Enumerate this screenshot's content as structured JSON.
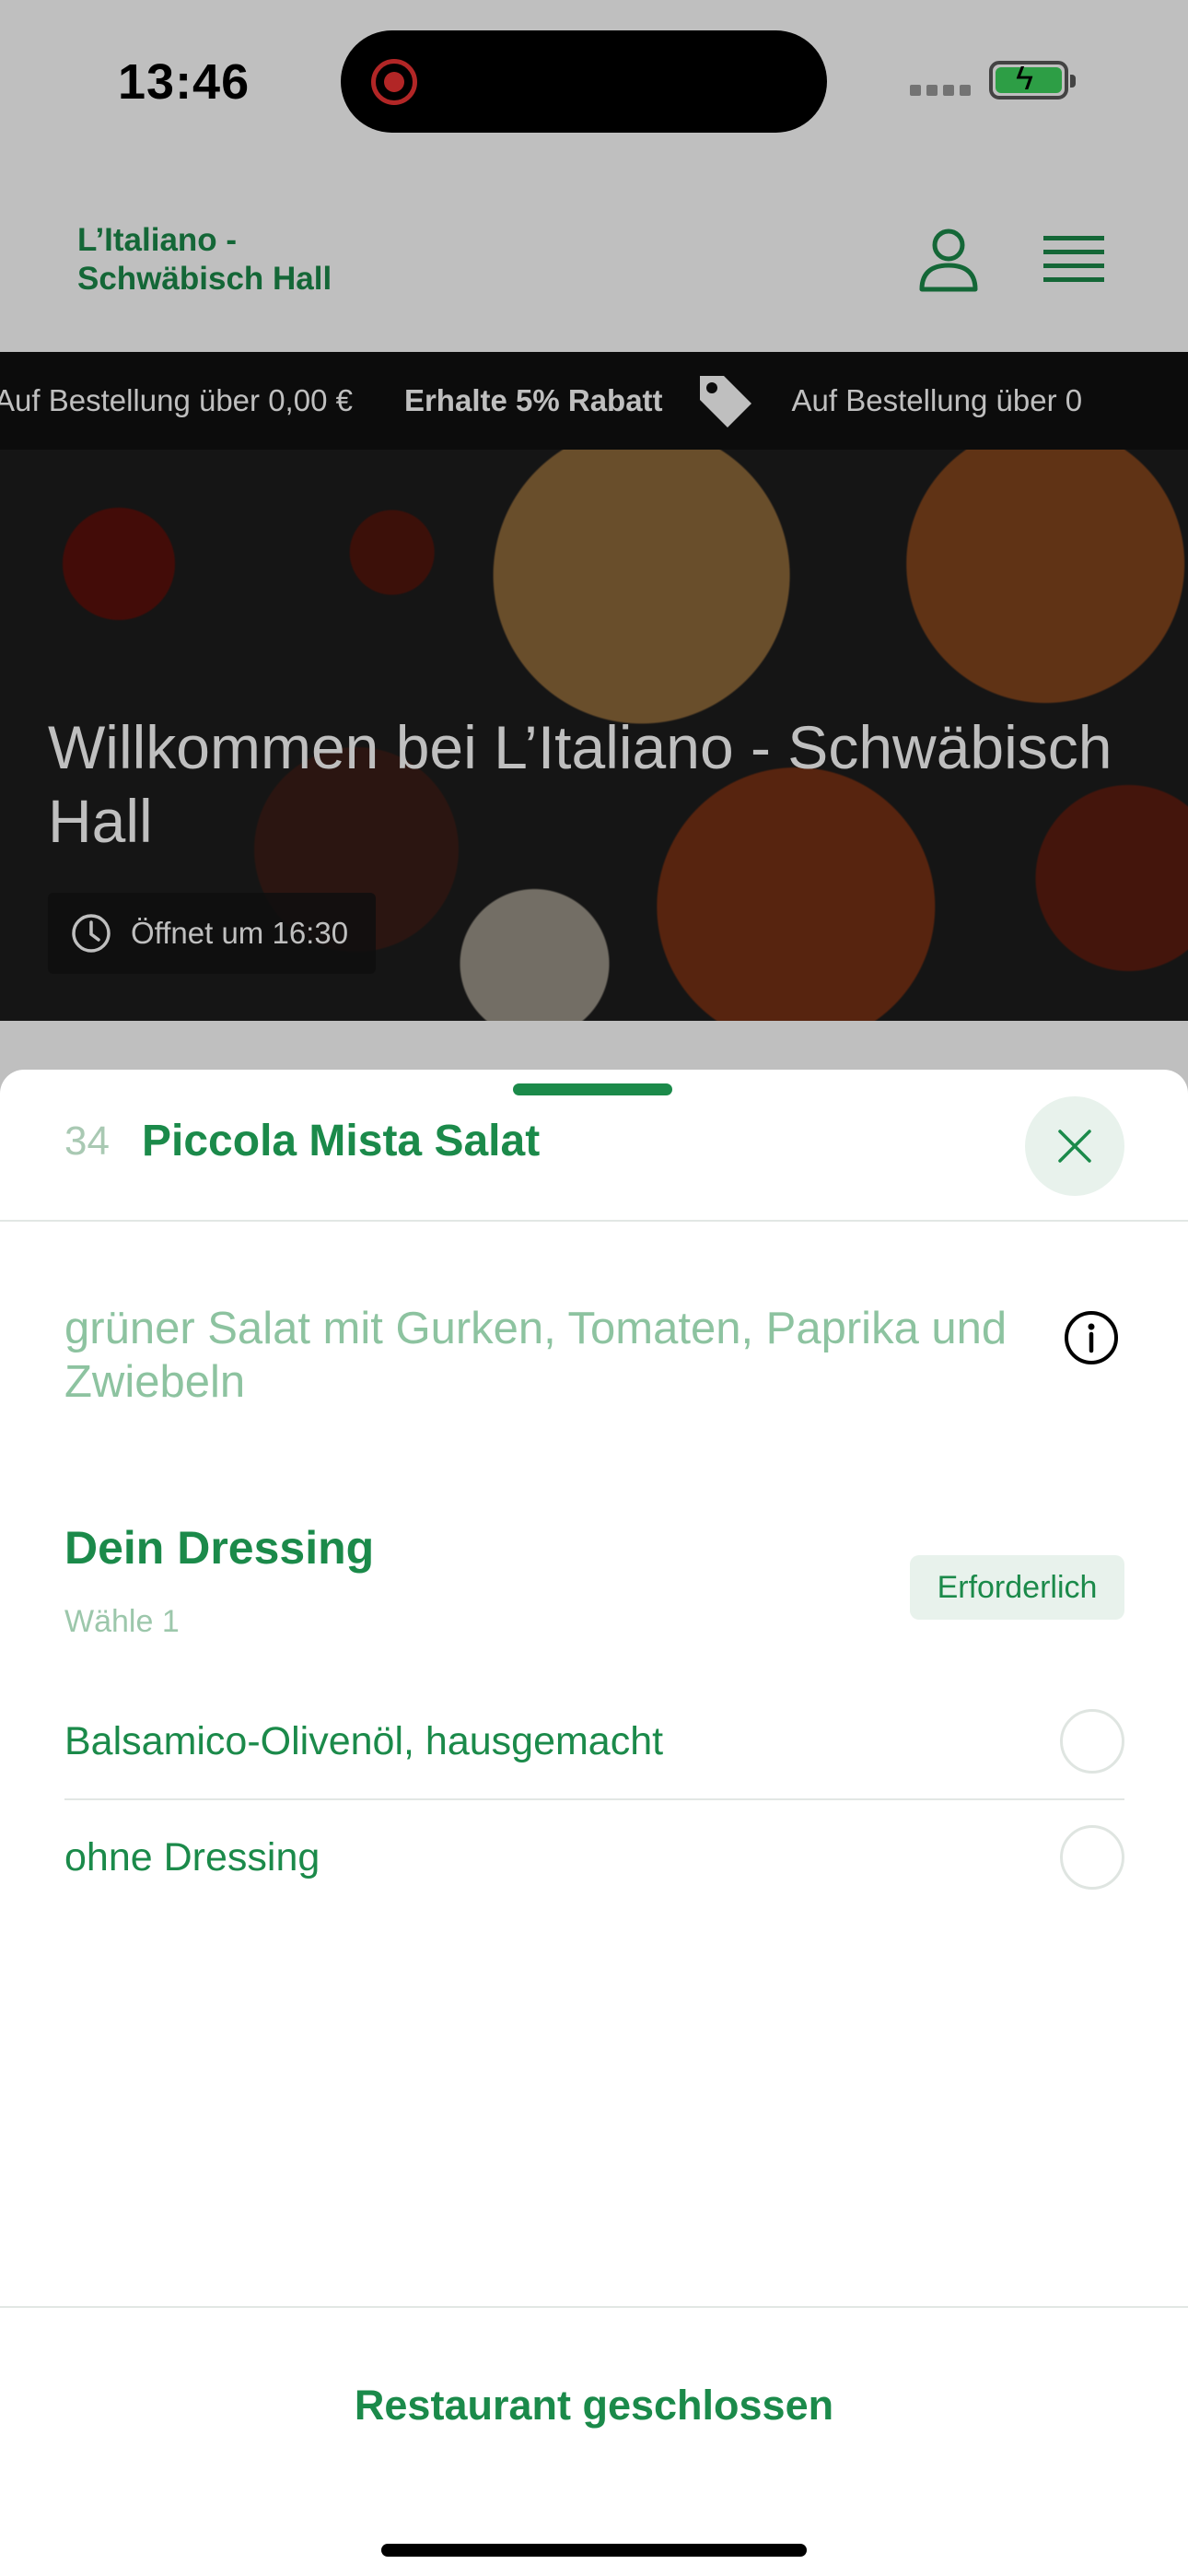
{
  "status_bar": {
    "time": "13:46"
  },
  "header": {
    "brand": "L’Italiano - Schwäbisch Hall"
  },
  "ticker": {
    "text_1": "Auf Bestellung über 0,00 €",
    "text_2": "Erhalte 5% Rabatt",
    "text_3": "Auf Bestellung über 0"
  },
  "hero": {
    "title": "Willkommen bei L’Italiano - Schwäbisch Hall",
    "opening": "Öffnet um 16:30"
  },
  "sheet": {
    "item_number": "34",
    "item_title": "Piccola Mista Salat",
    "description": "grüner Salat mit Gurken, Tomaten, Paprika und Zwiebeln",
    "group": {
      "title": "Dein Dressing",
      "subtitle": "Wähle 1",
      "badge": "Erforderlich",
      "options": [
        {
          "label": "Balsamico-Olivenöl, hausgemacht",
          "selected": false
        },
        {
          "label": "ohne Dressing",
          "selected": false
        }
      ]
    },
    "footer_button": "Restaurant geschlossen"
  },
  "colors": {
    "brand_green": "#1b8a4a",
    "light_green_text": "#8dc3a0",
    "badge_bg": "#e8f2ec"
  }
}
